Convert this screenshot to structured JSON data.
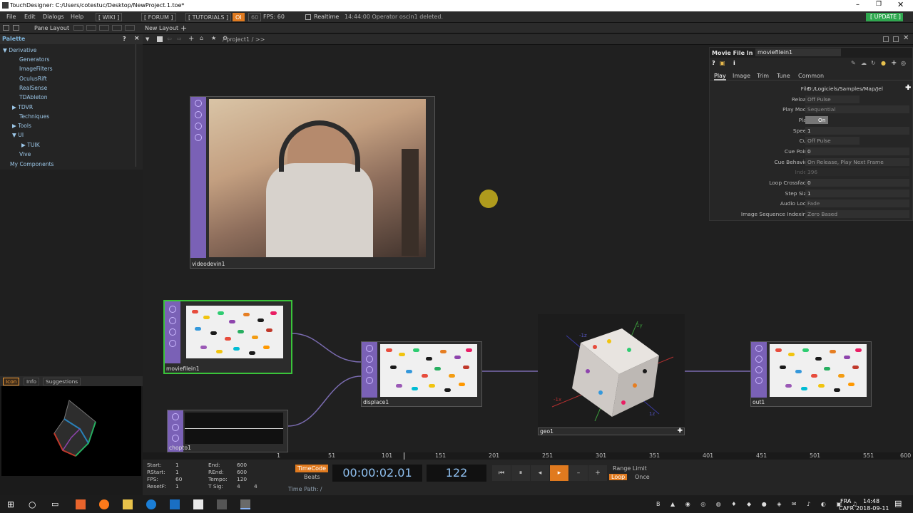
{
  "window": {
    "title": "TouchDesigner: C:/Users/cotestuc/Desktop/NewProject.1.toe*"
  },
  "menu": {
    "file": "File",
    "edit": "Edit",
    "dialogs": "Dialogs",
    "help": "Help",
    "wiki": "[ WIKI ]",
    "forum": "[ FORUM ]",
    "tutorials": "[ TUTORIALS ]",
    "oi": "OI",
    "sixty": "60",
    "fps": "FPS: 60",
    "realtime": "Realtime",
    "status": "14:44:00 Operator oscin1 deleted.",
    "update": "[ UPDATE ]"
  },
  "toolbar2": {
    "pane_layout": "Pane Layout",
    "new_layout": "New Layout"
  },
  "palette": {
    "title": "Palette",
    "help": "?",
    "close": "×",
    "items": [
      {
        "label": "Derivative",
        "expander": "▼"
      },
      {
        "label": "Generators",
        "expander": ""
      },
      {
        "label": "ImageFilters",
        "expander": ""
      },
      {
        "label": "OculusRift",
        "expander": ""
      },
      {
        "label": "RealSense",
        "expander": ""
      },
      {
        "label": "TDAbleton",
        "expander": ""
      },
      {
        "label": "TDVR",
        "expander": "▶"
      },
      {
        "label": "Techniques",
        "expander": ""
      },
      {
        "label": "Tools",
        "expander": "▶"
      },
      {
        "label": "UI",
        "expander": "▼"
      },
      {
        "label": "TUIK",
        "expander": "▶"
      },
      {
        "label": "Vive",
        "expander": ""
      },
      {
        "label": "My Components",
        "expander": ""
      }
    ]
  },
  "network": {
    "path": "/ project1 / >>"
  },
  "left_tabs": {
    "icon": "Icon",
    "info": "Info",
    "suggestions": "Suggestions"
  },
  "params": {
    "op_type": "Movie File In",
    "op_name": "moviefilein1",
    "help": "?",
    "info": "i",
    "tabs": [
      "Play",
      "Image",
      "Trim",
      "Tune",
      "Common"
    ],
    "rows": [
      {
        "label": "File",
        "value": "D:/Logiciels/Samples/Map/Jel"
      },
      {
        "label": "Reload",
        "value": "Off     Pulse"
      },
      {
        "label": "Play Mode",
        "value": "Sequential"
      },
      {
        "label": "Play",
        "value": "On"
      },
      {
        "label": "Speed",
        "value": "1"
      },
      {
        "label": "Cue",
        "value": "Off     Pulse"
      },
      {
        "label": "Cue Point",
        "value": "0"
      },
      {
        "label": "Cue Behavior",
        "value": "On Release, Play Next Frame"
      },
      {
        "label": "Index",
        "value": "396"
      },
      {
        "label": "Loop Crossfade",
        "value": "0"
      },
      {
        "label": "Step Size",
        "value": "1"
      },
      {
        "label": "Audio Loop",
        "value": "Fade"
      },
      {
        "label": "Image Sequence Indexing",
        "value": "Zero Based"
      }
    ]
  },
  "nodes": {
    "videodevin": "videodevin1",
    "moviefilein": "moviefilein1",
    "displace": "displace1",
    "geo": "geo1",
    "out": "out1",
    "chopto": "chopto1",
    "geo_axes": {
      "y": "1y",
      "z": "1z",
      "neg_x": "-1x",
      "neg_z": "-1z"
    }
  },
  "timeline": {
    "ticks": [
      "1",
      "51",
      "101",
      "151",
      "201",
      "251",
      "301",
      "351",
      "401",
      "451",
      "501",
      "551",
      "600"
    ]
  },
  "bottom": {
    "start_label": "Start:",
    "start": "1",
    "end_label": "End:",
    "end": "600",
    "rstart_label": "RStart:",
    "rstart": "1",
    "rend_label": "REnd:",
    "rend": "600",
    "fps_label": "FPS:",
    "fps": "60",
    "tempo_label": "Tempo:",
    "tempo": "120",
    "resetf_label": "ResetF:",
    "resetf": "1",
    "tsig_label": "T Sig:",
    "tsig_a": "4",
    "tsig_b": "4",
    "timecode_btn": "TimeCode",
    "beats_btn": "Beats",
    "timecode": "00:00:02.01",
    "frame": "122",
    "range_limit": "Range Limit",
    "loop": "Loop",
    "once": "Once",
    "time_path": "Time Path: /"
  },
  "taskbar": {
    "lang": "FRA",
    "layout": "CAFR",
    "time": "14:48",
    "date": "2018-09-11"
  }
}
